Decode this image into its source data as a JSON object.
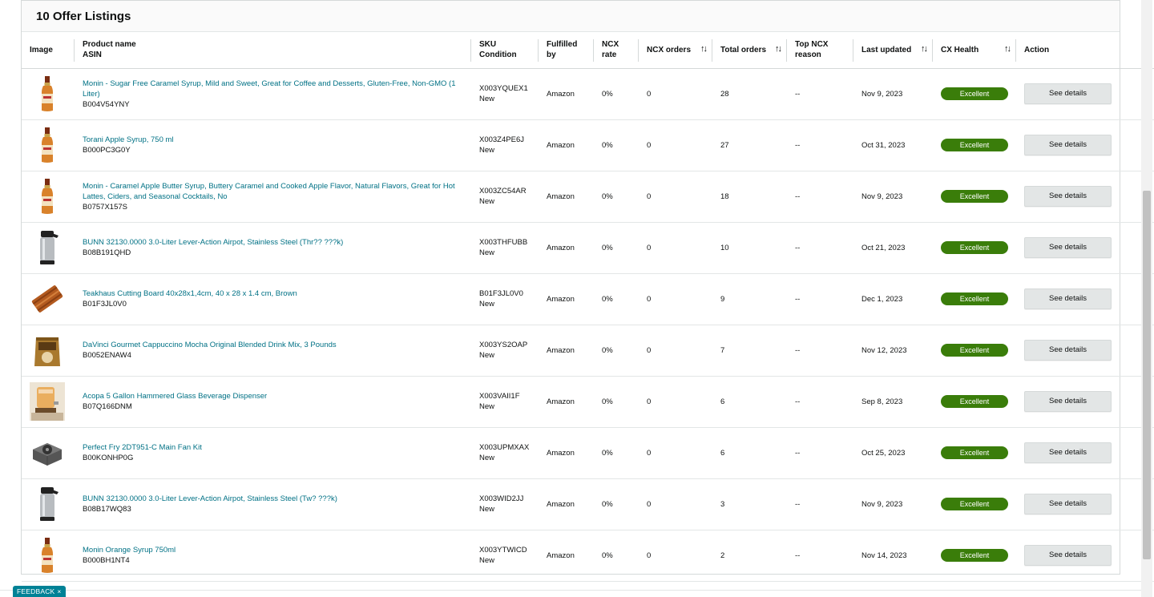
{
  "panel": {
    "title": "10 Offer Listings"
  },
  "columns": {
    "image": "Image",
    "product_name": "Product name",
    "asin": "ASIN",
    "sku": "SKU",
    "condition": "Condition",
    "fulfilled_by": "Fulfilled by",
    "ncx_rate": "NCX rate",
    "ncx_orders": "NCX orders",
    "total_orders": "Total orders",
    "top_ncx_reason_1": "Top NCX",
    "top_ncx_reason_2": "reason",
    "last_updated": "Last updated",
    "cx_health": "CX Health",
    "action": "Action",
    "sort_icon": "↑↓"
  },
  "rows": [
    {
      "icon": "syrup-bottle-icon",
      "name": "Monin - Sugar Free Caramel Syrup, Mild and Sweet, Great for Coffee and Desserts, Gluten-Free, Non-GMO (1 Liter)",
      "asin": "B004V54YNY",
      "sku": "X003YQUEX1",
      "condition": "New",
      "fulfilled": "Amazon",
      "ncx_rate": "0%",
      "ncx_orders": "0",
      "total_orders": "28",
      "reason": "--",
      "updated": "Nov 9, 2023",
      "health": "Excellent",
      "action": "See details"
    },
    {
      "icon": "syrup-bottle-icon",
      "name": "Torani Apple Syrup, 750 ml",
      "asin": "B000PC3G0Y",
      "sku": "X003Z4PE6J",
      "condition": "New",
      "fulfilled": "Amazon",
      "ncx_rate": "0%",
      "ncx_orders": "0",
      "total_orders": "27",
      "reason": "--",
      "updated": "Oct 31, 2023",
      "health": "Excellent",
      "action": "See details"
    },
    {
      "icon": "syrup-bottle-icon",
      "name": "Monin - Caramel Apple Butter Syrup, Buttery Caramel and Cooked Apple Flavor, Natural Flavors, Great for Hot Lattes, Ciders, and Seasonal Cocktails, No",
      "asin": "B0757X157S",
      "sku": "X003ZC54AR",
      "condition": "New",
      "fulfilled": "Amazon",
      "ncx_rate": "0%",
      "ncx_orders": "0",
      "total_orders": "18",
      "reason": "--",
      "updated": "Nov 9, 2023",
      "health": "Excellent",
      "action": "See details"
    },
    {
      "icon": "airpot-icon",
      "name": "BUNN 32130.0000 3.0-Liter Lever-Action Airpot, Stainless Steel (Thr?? ???k)",
      "asin": "B08B191QHD",
      "sku": "X003THFUBB",
      "condition": "New",
      "fulfilled": "Amazon",
      "ncx_rate": "0%",
      "ncx_orders": "0",
      "total_orders": "10",
      "reason": "--",
      "updated": "Oct 21, 2023",
      "health": "Excellent",
      "action": "See details"
    },
    {
      "icon": "cutting-board-icon",
      "name": "Teakhaus Cutting Board 40x28x1,4cm, 40 x 28 x 1.4 cm, Brown",
      "asin": "B01F3JL0V0",
      "sku": "B01F3JL0V0",
      "condition": "New",
      "fulfilled": "Amazon",
      "ncx_rate": "0%",
      "ncx_orders": "0",
      "total_orders": "9",
      "reason": "--",
      "updated": "Dec 1, 2023",
      "health": "Excellent",
      "action": "See details"
    },
    {
      "icon": "drink-mix-bag-icon",
      "name": "DaVinci Gourmet Cappuccino Mocha Original Blended Drink Mix, 3 Pounds",
      "asin": "B0052ENAW4",
      "sku": "X003YS2OAP",
      "condition": "New",
      "fulfilled": "Amazon",
      "ncx_rate": "0%",
      "ncx_orders": "0",
      "total_orders": "7",
      "reason": "--",
      "updated": "Nov 12, 2023",
      "health": "Excellent",
      "action": "See details"
    },
    {
      "icon": "beverage-dispenser-icon",
      "name": "Acopa 5 Gallon Hammered Glass Beverage Dispenser",
      "asin": "B07Q166DNM",
      "sku": "X003VAII1F",
      "condition": "New",
      "fulfilled": "Amazon",
      "ncx_rate": "0%",
      "ncx_orders": "0",
      "total_orders": "6",
      "reason": "--",
      "updated": "Sep 8, 2023",
      "health": "Excellent",
      "action": "See details"
    },
    {
      "icon": "fan-kit-icon",
      "name": "Perfect Fry 2DT951-C Main Fan Kit",
      "asin": "B00KONHP0G",
      "sku": "X003UPMXAX",
      "condition": "New",
      "fulfilled": "Amazon",
      "ncx_rate": "0%",
      "ncx_orders": "0",
      "total_orders": "6",
      "reason": "--",
      "updated": "Oct 25, 2023",
      "health": "Excellent",
      "action": "See details"
    },
    {
      "icon": "airpot-icon",
      "name": "BUNN 32130.0000 3.0-Liter Lever-Action Airpot, Stainless Steel (Tw? ???k)",
      "asin": "B08B17WQ83",
      "sku": "X003WID2JJ",
      "condition": "New",
      "fulfilled": "Amazon",
      "ncx_rate": "0%",
      "ncx_orders": "0",
      "total_orders": "3",
      "reason": "--",
      "updated": "Nov 9, 2023",
      "health": "Excellent",
      "action": "See details"
    },
    {
      "icon": "syrup-bottle-icon",
      "name": "Monin Orange Syrup 750ml",
      "asin": "B000BH1NT4",
      "sku": "X003YTWICD",
      "condition": "New",
      "fulfilled": "Amazon",
      "ncx_rate": "0%",
      "ncx_orders": "0",
      "total_orders": "2",
      "reason": "--",
      "updated": "Nov 14, 2023",
      "health": "Excellent",
      "action": "See details"
    }
  ],
  "feedback": {
    "label": "FEEDBACK",
    "close": "×"
  },
  "colors": {
    "link": "#007185",
    "health_excellent": "#3a7d0a",
    "feedback": "#008296"
  }
}
